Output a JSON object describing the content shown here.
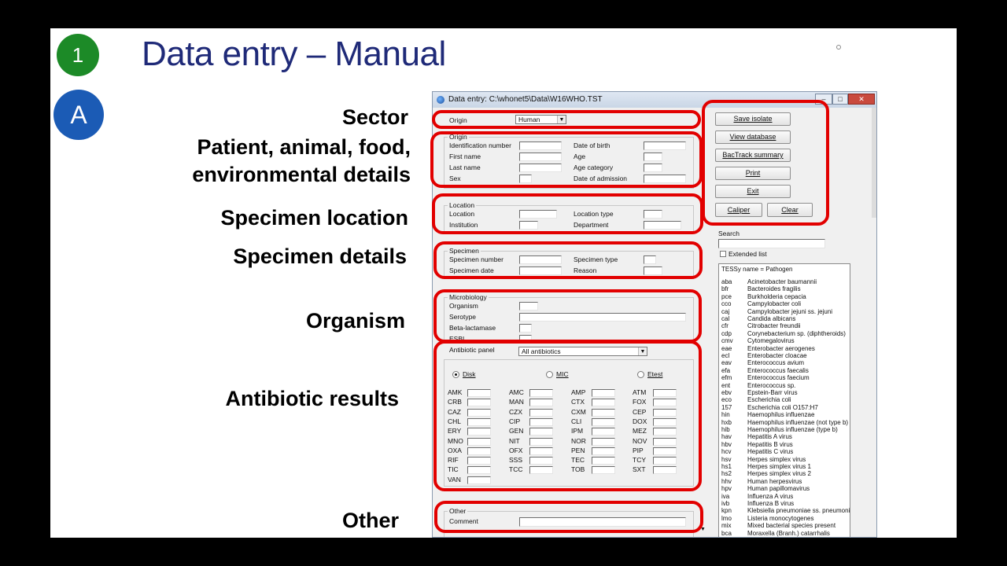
{
  "slide": {
    "badge1": "1",
    "badgeA": "A",
    "title": "Data entry – Manual"
  },
  "labels": {
    "sector": "Sector",
    "patient1": "Patient, animal, food,",
    "patient2": "environmental details",
    "location": "Specimen location",
    "specimen": "Specimen details",
    "organism": "Organism",
    "antibiotic": "Antibiotic results",
    "other": "Other"
  },
  "window": {
    "title": "Data entry:  C:\\whonet5\\Data\\W16WHO.TST",
    "origin_label": "Origin",
    "origin_value": "Human",
    "groups": {
      "origin": "Origin",
      "location": "Location",
      "specimen": "Specimen",
      "microbiology": "Microbiology",
      "other": "Other"
    },
    "fields": {
      "id_number": "Identification number",
      "first_name": "First name",
      "last_name": "Last name",
      "sex": "Sex",
      "dob": "Date of birth",
      "age": "Age",
      "age_category": "Age category",
      "admission": "Date of admission",
      "location": "Location",
      "institution": "Institution",
      "location_type": "Location type",
      "department": "Department",
      "specimen_number": "Specimen number",
      "specimen_date": "Specimen date",
      "specimen_type": "Specimen type",
      "reason": "Reason",
      "organism": "Organism",
      "serotype": "Serotype",
      "beta_lactamase": "Beta-lactamase",
      "esbl": "ESBL",
      "antibiotic_panel": "Antibiotic panel",
      "panel_value": "All antibiotics",
      "comment": "Comment"
    },
    "methods": {
      "disk": "Disk",
      "mic": "MIC",
      "etest": "Etest"
    },
    "antibiotics": [
      [
        "AMK",
        "AMC",
        "AMP",
        "ATM"
      ],
      [
        "CRB",
        "MAN",
        "CTX",
        "FOX"
      ],
      [
        "CAZ",
        "CZX",
        "CXM",
        "CEP"
      ],
      [
        "CHL",
        "CIP",
        "CLI",
        "DOX"
      ],
      [
        "ERY",
        "GEN",
        "IPM",
        "MEZ"
      ],
      [
        "MNO",
        "NIT",
        "NOR",
        "NOV"
      ],
      [
        "OXA",
        "OFX",
        "PEN",
        "PIP"
      ],
      [
        "RIF",
        "SSS",
        "TEC",
        "TCY"
      ],
      [
        "TIC",
        "TCC",
        "TOB",
        "SXT"
      ],
      [
        "VAN",
        "",
        "",
        ""
      ]
    ],
    "buttons": {
      "save": "Save isolate",
      "view": "View database",
      "bactrack": "BacTrack summary",
      "print": "Print",
      "exit": "Exit",
      "caliper": "Caliper",
      "clear": "Clear"
    },
    "search_label": "Search",
    "extended_list": "Extended list",
    "list_header": "TESSy name = Pathogen",
    "organisms": [
      [
        "aba",
        "Acinetobacter baumannii"
      ],
      [
        "bfr",
        "Bacteroides fragilis"
      ],
      [
        "pce",
        "Burkholderia cepacia"
      ],
      [
        "cco",
        "Campylobacter coli"
      ],
      [
        "caj",
        "Campylobacter jejuni ss. jejuni"
      ],
      [
        "cal",
        "Candida albicans"
      ],
      [
        "cfr",
        "Citrobacter freundii"
      ],
      [
        "cdp",
        "Corynebacterium sp. (diphtheroids)"
      ],
      [
        "cmv",
        "Cytomegalovirus"
      ],
      [
        "eae",
        "Enterobacter aerogenes"
      ],
      [
        "ecl",
        "Enterobacter cloacae"
      ],
      [
        "eav",
        "Enterococcus avium"
      ],
      [
        "efa",
        "Enterococcus faecalis"
      ],
      [
        "efm",
        "Enterococcus faecium"
      ],
      [
        "ent",
        "Enterococcus sp."
      ],
      [
        "ebv",
        "Epstein-Barr virus"
      ],
      [
        "eco",
        "Escherichia coli"
      ],
      [
        "157",
        "Escherichia coli O157:H7"
      ],
      [
        "hin",
        "Haemophilus influenzae"
      ],
      [
        "hxb",
        "Haemophilus influenzae (not type b)"
      ],
      [
        "hib",
        "Haemophilus influenzae (type b)"
      ],
      [
        "hav",
        "Hepatitis A virus"
      ],
      [
        "hbv",
        "Hepatitis B virus"
      ],
      [
        "hcv",
        "Hepatitis C virus"
      ],
      [
        "hsv",
        "Herpes simplex virus"
      ],
      [
        "hs1",
        "Herpes simplex virus 1"
      ],
      [
        "hs2",
        "Herpes simplex virus 2"
      ],
      [
        "hhv",
        "Human herpesvirus"
      ],
      [
        "hpv",
        "Human papillomavirus"
      ],
      [
        "iva",
        "Influenza A virus"
      ],
      [
        "ivb",
        "Influenza B virus"
      ],
      [
        "kpn",
        "Klebsiella pneumoniae ss. pneumoniae"
      ],
      [
        "lmo",
        "Listeria monocytogenes"
      ],
      [
        "mix",
        "Mixed bacterial species present"
      ],
      [
        "bca",
        "Moraxella (Branh.) catarrhalis"
      ]
    ],
    "colors": {
      "highlight": "#e20000",
      "title": "#1f2a78",
      "badge1": "#1c8a27",
      "badgeA": "#1b5bb5"
    }
  }
}
